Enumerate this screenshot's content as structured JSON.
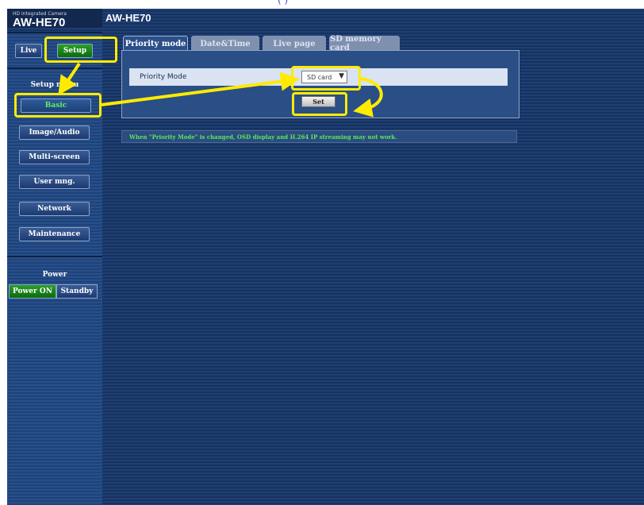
{
  "header": {
    "brand_sub": "HD Integrated Camera",
    "brand_name": "AW-HE70",
    "title": "AW-HE70",
    "top_caption": "(               )"
  },
  "sidebar": {
    "live_label": "Live",
    "setup_label": "Setup",
    "setup_menu_label": "Setup menu",
    "menu_items": [
      "Basic",
      "Image/Audio",
      "Multi-screen",
      "User mng.",
      "Network",
      "Maintenance"
    ],
    "power_label": "Power",
    "power_on_label": "Power ON",
    "standby_label": "Standby"
  },
  "tabs": [
    "Priority mode",
    "Date&Time",
    "Live page",
    "SD memory card"
  ],
  "form": {
    "priority_mode_label": "Priority Mode",
    "select_value": "SD card",
    "set_label": "Set"
  },
  "notice": "When \"Priority Mode\" is changed, OSD display and H.264 IP streaming may not work.",
  "colors": {
    "highlight": "#ffeb00",
    "active_green": "#2aa02a",
    "background_blue": "#1c3a6b"
  }
}
